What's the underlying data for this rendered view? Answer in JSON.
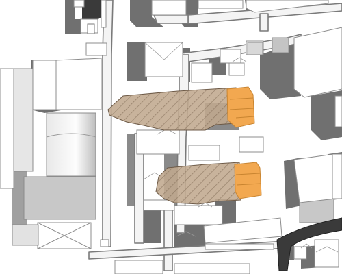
{
  "map": {
    "view": "3d-massing-site-plan",
    "colors": {
      "background": "#ffffff",
      "road_fill": "#f4f4f4",
      "road_edge": "#7a7a7a",
      "building_roof": "#ffffff",
      "building_outline": "#8c8c8c",
      "shadow": "#707070",
      "shadow_light": "#a9a9a9",
      "plaza": "#c8c8c8",
      "dark_road": "#3a3a3a",
      "proposed_mass": "#c0a88e",
      "proposed_hatch": "#7d6752",
      "proposed_highlight": "#f2a850",
      "proposed_highlight_edge": "#c88430"
    },
    "features": {
      "proposed_developments": [
        "north-block",
        "south-block"
      ],
      "highlighted_facades": [
        "north-block-east",
        "south-block-east"
      ]
    }
  }
}
